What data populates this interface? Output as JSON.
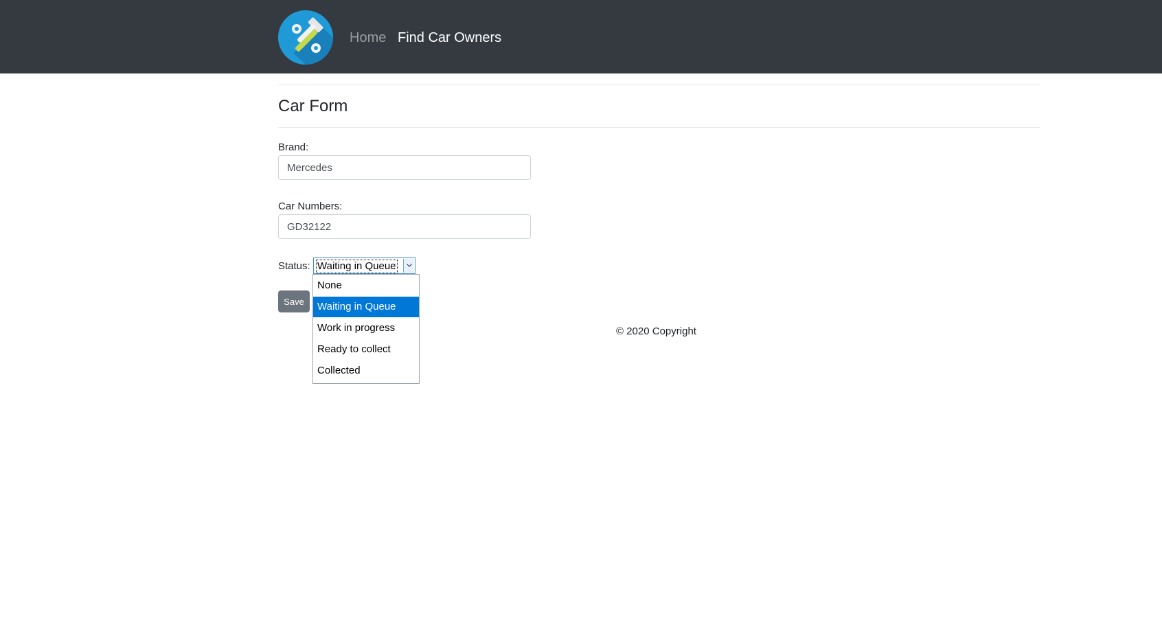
{
  "navbar": {
    "logo_icon": "tools-wrench-hammer-icon",
    "links": [
      {
        "label": "Home",
        "state": "inactive"
      },
      {
        "label": "Find Car Owners",
        "state": "active"
      }
    ],
    "background_color": "#343a40"
  },
  "form": {
    "title": "Car Form",
    "brand": {
      "label": "Brand:",
      "value": "Mercedes"
    },
    "car_numbers": {
      "label": "Car Numbers:",
      "value": "GD32122"
    },
    "status": {
      "label": "Status:",
      "selected": "Waiting in Queue",
      "expanded": true,
      "options": [
        "None",
        "Waiting in Queue",
        "Work in progress",
        "Ready to collect",
        "Collected"
      ],
      "highlight_color": "#0078d7"
    },
    "save_label": "Save"
  },
  "footer": {
    "copyright": "© 2020 Copyright"
  }
}
